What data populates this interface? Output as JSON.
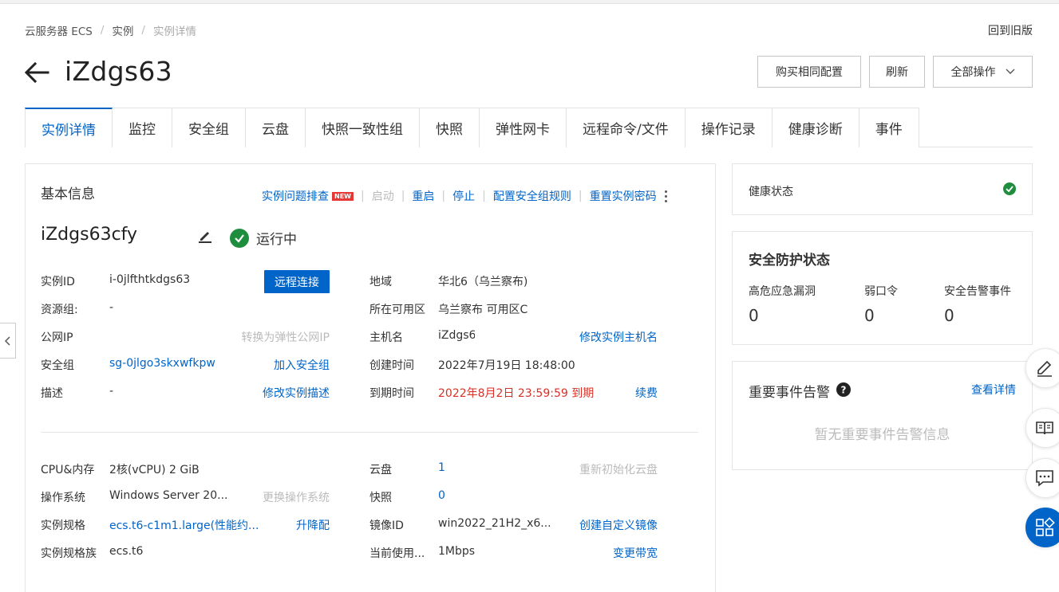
{
  "breadcrumb": {
    "root": "云服务器 ECS",
    "level2": "实例",
    "current": "实例详情"
  },
  "header": {
    "old_version": "回到旧版",
    "title": "iZdgs63",
    "buy_same": "购买相同配置",
    "refresh": "刷新",
    "all_ops": "全部操作"
  },
  "tabs": [
    "实例详情",
    "监控",
    "安全组",
    "云盘",
    "快照一致性组",
    "快照",
    "弹性网卡",
    "远程命令/文件",
    "操作记录",
    "健康诊断",
    "事件"
  ],
  "basic": {
    "title": "基本信息",
    "ops": {
      "troubleshoot": "实例问题排查",
      "new_badge": "NEW",
      "start": "启动",
      "restart": "重启",
      "stop": "停止",
      "sg_rules": "配置安全组规则",
      "reset_pwd": "重置实例密码"
    },
    "instance_name": "iZdgs63cfy",
    "status": "运行中",
    "rows": {
      "instance_id_label": "实例ID",
      "instance_id": "i-0jlfthtkdgs63",
      "remote_connect": "远程连接",
      "region_label": "地域",
      "region": "华北6（乌兰察布)",
      "rg_label": "资源组:",
      "rg": "-",
      "zone_label": "所在可用区",
      "zone": "乌兰察布 可用区C",
      "public_ip_label": "公网IP",
      "convert_eip": "转换为弹性公网IP",
      "hostname_label": "主机名",
      "hostname": "iZdgs6",
      "modify_hostname": "修改实例主机名",
      "sg_label": "安全组",
      "sg": "sg-0jlgo3skxwfkpw",
      "join_sg": "加入安全组",
      "created_label": "创建时间",
      "created": "2022年7月19日 18:48:00",
      "desc_label": "描述",
      "desc": "-",
      "modify_desc": "修改实例描述",
      "expire_label": "到期时间",
      "expire": "2022年8月2日 23:59:59 到期",
      "renew": "续费"
    },
    "config": {
      "cpu_label": "CPU&内存",
      "cpu": "2核(vCPU) 2 GiB",
      "disk_label": "云盘",
      "disk": "1",
      "reinit_disk": "重新初始化云盘",
      "os_label": "操作系统",
      "os": "Windows Server 20...",
      "change_os": "更换操作系统",
      "snapshot_label": "快照",
      "snapshot": "0",
      "spec_label": "实例规格",
      "spec": "ecs.t6-c1m1.large(性能约...",
      "upgrade": "升降配",
      "image_label": "镜像ID",
      "image": "win2022_21H2_x6...",
      "create_image": "创建自定义镜像",
      "family_label": "实例规格族",
      "family": "ecs.t6",
      "bandwidth_label": "当前使用...",
      "bandwidth": "1Mbps",
      "change_bw": "变更带宽"
    }
  },
  "health": {
    "label": "健康状态"
  },
  "security": {
    "title": "安全防护状态",
    "items": [
      {
        "label": "高危应急漏洞",
        "value": "0"
      },
      {
        "label": "弱口令",
        "value": "0"
      },
      {
        "label": "安全告警事件",
        "value": "0"
      }
    ]
  },
  "events": {
    "title": "重要事件告警",
    "view_details": "查看详情",
    "empty": "暂无重要事件告警信息"
  },
  "icons": [
    "arrow-left-icon",
    "chevron-down-icon",
    "edit-icon",
    "check-circle-icon",
    "more-vertical-icon",
    "question-icon",
    "chevron-left-icon",
    "pencil-icon",
    "book-icon",
    "chat-icon",
    "apps-icon"
  ],
  "colors": {
    "primary": "#0064c8",
    "success": "#1e8e3e",
    "danger": "#d93026",
    "muted": "#bbbbbb"
  }
}
